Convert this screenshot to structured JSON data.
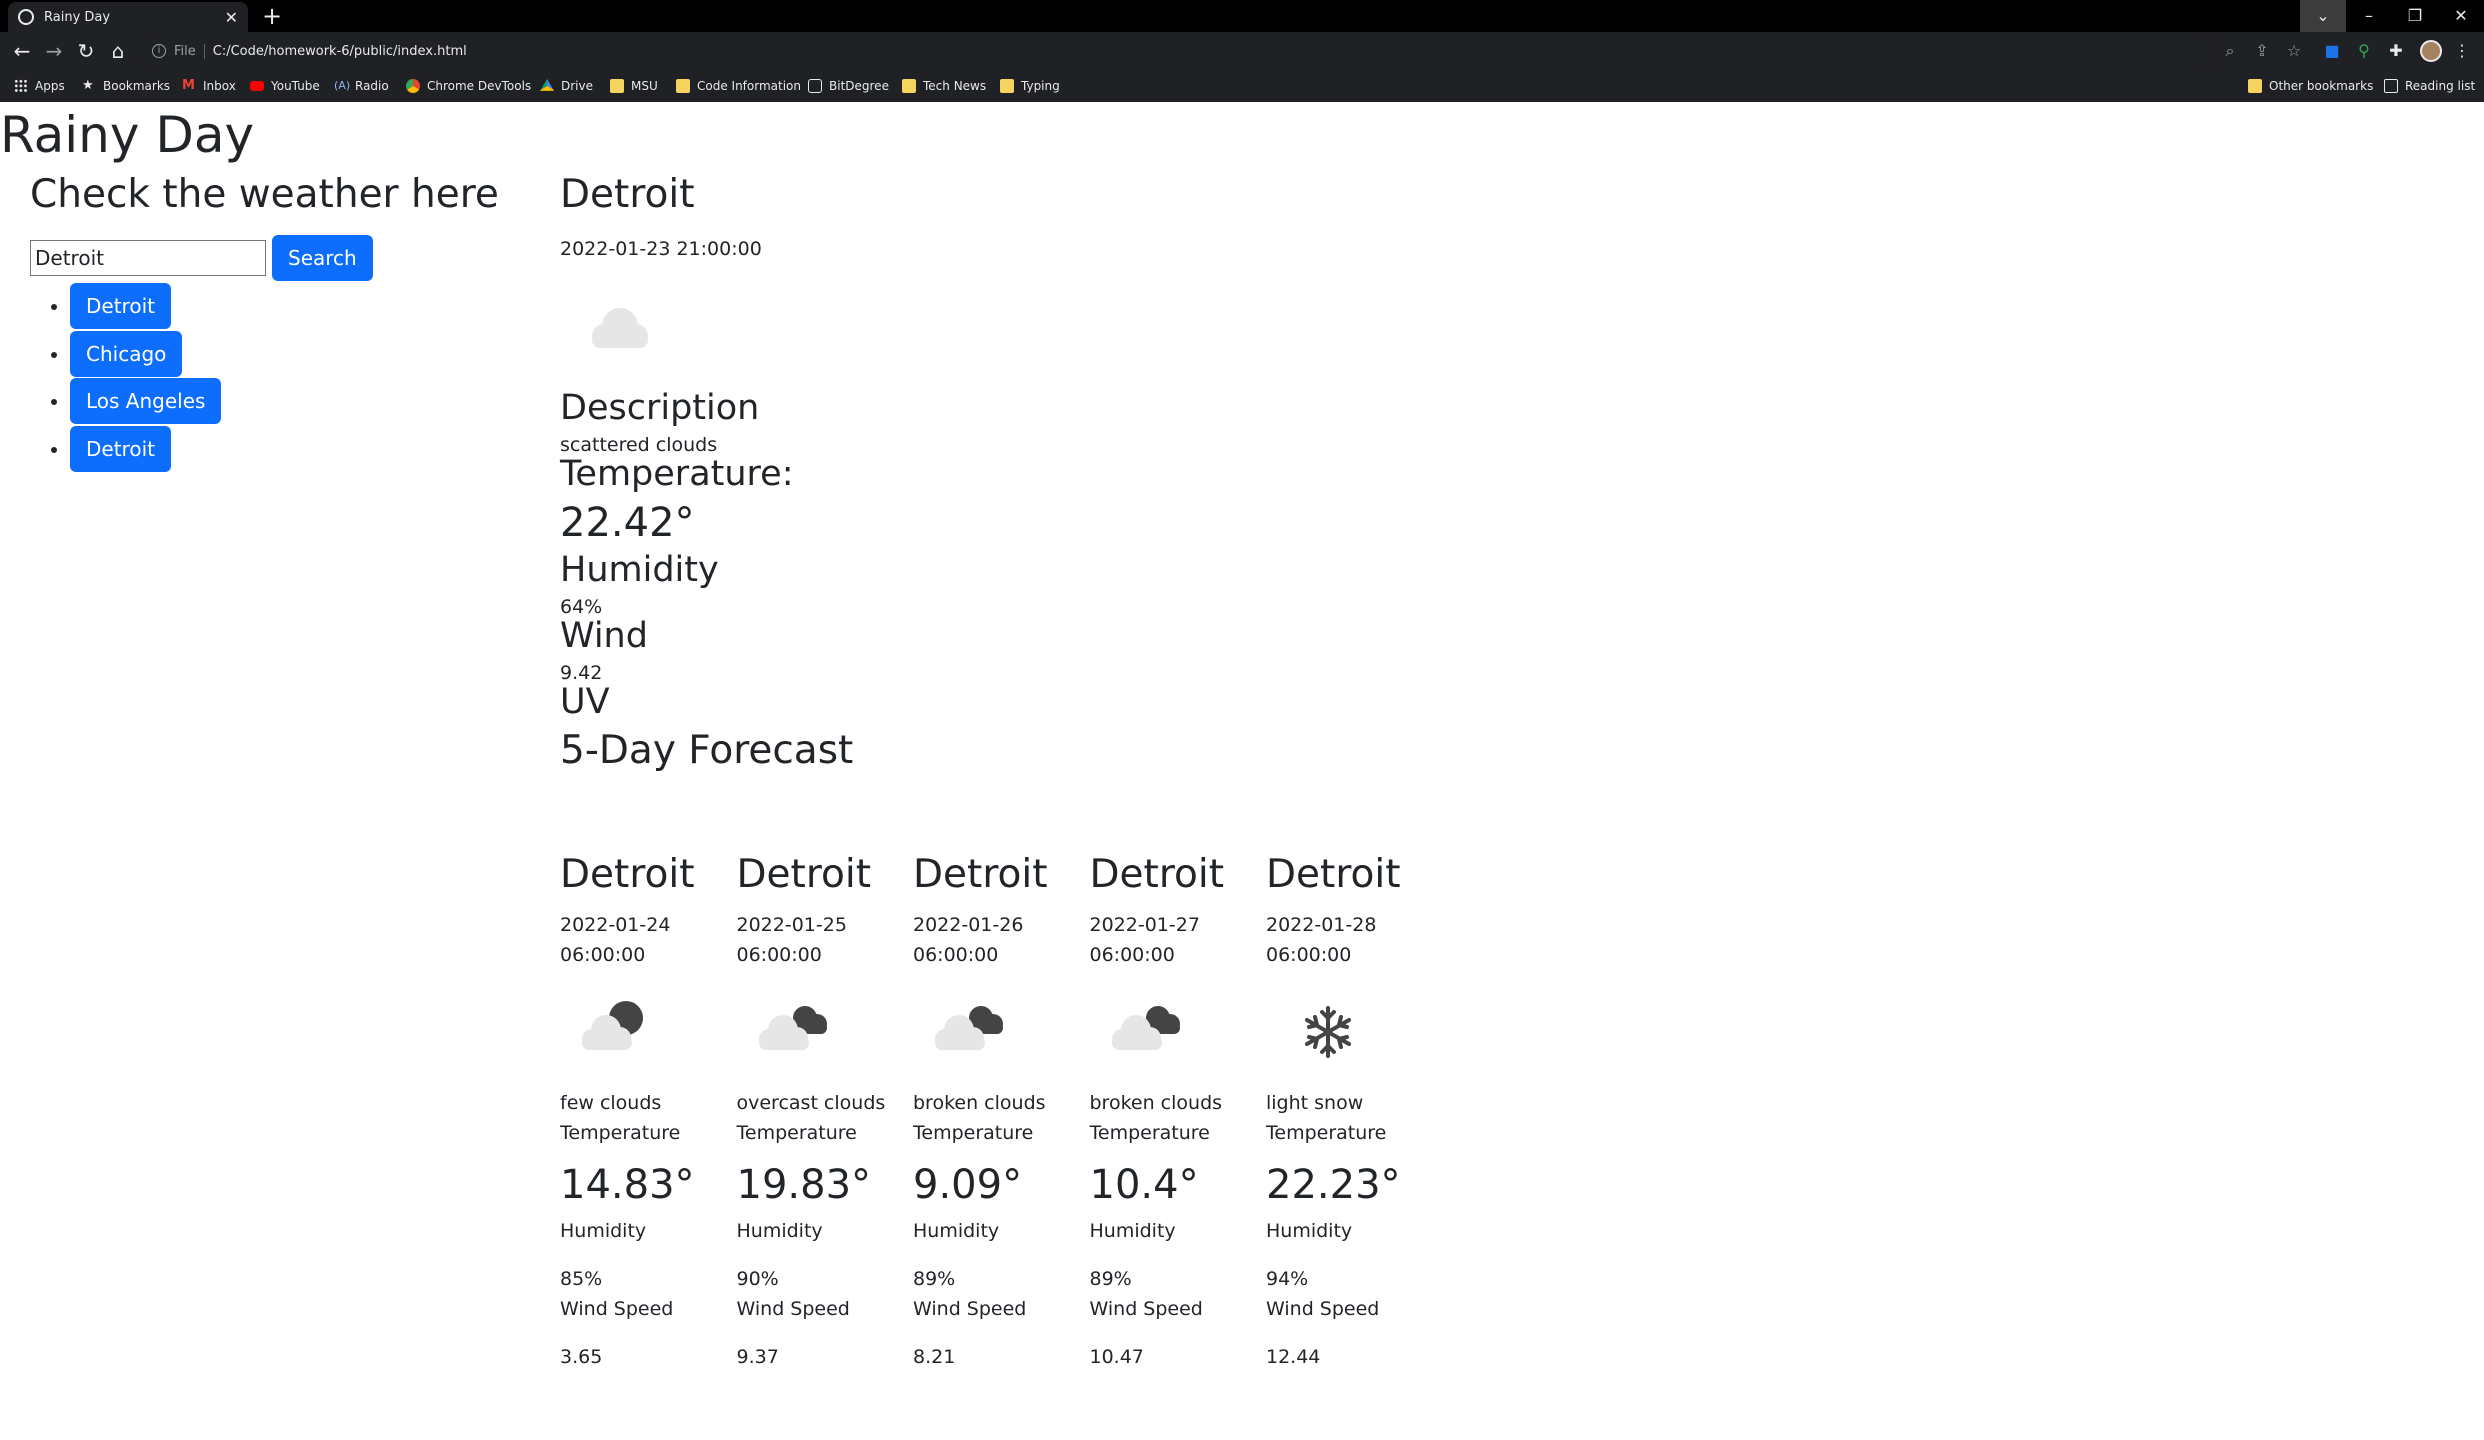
{
  "browser": {
    "tab_title": "Rainy Day",
    "scheme": "File",
    "url": "C:/Code/homework-6/public/index.html",
    "bookmarks": [
      {
        "label": "Apps",
        "icon": "apps-grid-icon"
      },
      {
        "label": "Bookmarks",
        "icon": "star-icon"
      },
      {
        "label": "Inbox",
        "icon": "gmail-icon"
      },
      {
        "label": "YouTube",
        "icon": "youtube-icon"
      },
      {
        "label": "Radio",
        "icon": "radio-icon"
      },
      {
        "label": "Chrome DevTools",
        "icon": "chrome-icon"
      },
      {
        "label": "Drive",
        "icon": "drive-icon"
      },
      {
        "label": "MSU",
        "icon": "folder-icon"
      },
      {
        "label": "Code Information",
        "icon": "folder-icon"
      },
      {
        "label": "BitDegree",
        "icon": "bitdegree-icon"
      },
      {
        "label": "Tech News",
        "icon": "folder-icon"
      },
      {
        "label": "Typing",
        "icon": "folder-icon"
      }
    ],
    "other_bookmarks": "Other bookmarks",
    "reading_list": "Reading list"
  },
  "page": {
    "title": "Rainy Day",
    "search_heading": "Check the weather here",
    "search_value": "Detroit",
    "search_button": "Search",
    "history": [
      "Detroit",
      "Chicago",
      "Los Angeles",
      "Detroit"
    ]
  },
  "current": {
    "city": "Detroit",
    "date": "2022-01-23 21:00:00",
    "icon": "scattered-clouds-icon",
    "description_heading": "Description",
    "description": "scattered clouds",
    "temperature_heading": "Temperature:",
    "temperature": "22.42°",
    "humidity_heading": "Humidity",
    "humidity": "64%",
    "wind_heading": "Wind",
    "wind": "9.42",
    "uv_heading": "UV"
  },
  "forecast_heading": "5-Day Forecast",
  "forecast": [
    {
      "city": "Detroit",
      "date": "2022-01-24",
      "time": "06:00:00",
      "icon": "few-clouds-night-icon",
      "description": "few clouds",
      "temp_label": "Temperature",
      "temperature": "14.83°",
      "humidity_label": "Humidity",
      "humidity": "85%",
      "wind_label": "Wind Speed",
      "wind": "3.65"
    },
    {
      "city": "Detroit",
      "date": "2022-01-25",
      "time": "06:00:00",
      "icon": "broken-clouds-icon",
      "description": "overcast clouds",
      "temp_label": "Temperature",
      "temperature": "19.83°",
      "humidity_label": "Humidity",
      "humidity": "90%",
      "wind_label": "Wind Speed",
      "wind": "9.37"
    },
    {
      "city": "Detroit",
      "date": "2022-01-26",
      "time": "06:00:00",
      "icon": "broken-clouds-icon",
      "description": "broken clouds",
      "temp_label": "Temperature",
      "temperature": "9.09°",
      "humidity_label": "Humidity",
      "humidity": "89%",
      "wind_label": "Wind Speed",
      "wind": "8.21"
    },
    {
      "city": "Detroit",
      "date": "2022-01-27",
      "time": "06:00:00",
      "icon": "broken-clouds-icon",
      "description": "broken clouds",
      "temp_label": "Temperature",
      "temperature": "10.4°",
      "humidity_label": "Humidity",
      "humidity": "89%",
      "wind_label": "Wind Speed",
      "wind": "10.47"
    },
    {
      "city": "Detroit",
      "date": "2022-01-28",
      "time": "06:00:00",
      "icon": "snowflake-icon",
      "description": "light snow",
      "temp_label": "Temperature",
      "temperature": "22.23°",
      "humidity_label": "Humidity",
      "humidity": "94%",
      "wind_label": "Wind Speed",
      "wind": "12.44"
    }
  ],
  "colors": {
    "primary_button": "#0d6efd",
    "text": "#212529",
    "chrome_dark": "#202124"
  }
}
